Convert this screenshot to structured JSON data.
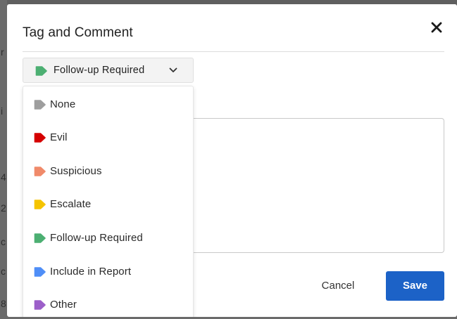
{
  "dialog": {
    "title": "Tag and Comment",
    "close_icon": "close-icon",
    "cancel_label": "Cancel",
    "save_label": "Save",
    "save_color": "#1c62c7"
  },
  "tag_select": {
    "selected_label": "Follow-up Required",
    "selected_color": "#4caf72",
    "chevron_icon": "chevron-down-icon"
  },
  "tag_options": [
    {
      "label": "None",
      "color": "#9e9e9e",
      "icon": "tag-icon"
    },
    {
      "label": "Evil",
      "color": "#d50000",
      "icon": "tag-icon"
    },
    {
      "label": "Suspicious",
      "color": "#f08a6a",
      "icon": "tag-icon"
    },
    {
      "label": "Escalate",
      "color": "#f5c400",
      "icon": "tag-icon"
    },
    {
      "label": "Follow-up Required",
      "color": "#4caf72",
      "icon": "tag-icon"
    },
    {
      "label": "Include in Report",
      "color": "#4f8ef7",
      "icon": "tag-icon"
    },
    {
      "label": "Other",
      "color": "#9c5fc9",
      "icon": "tag-icon"
    }
  ]
}
